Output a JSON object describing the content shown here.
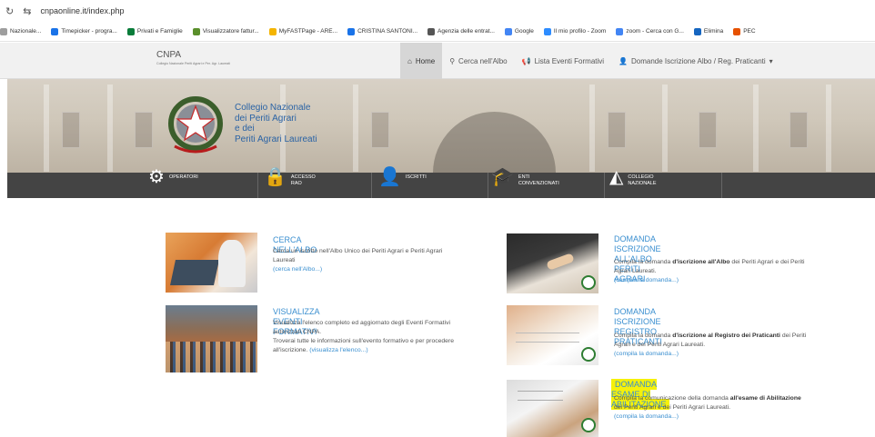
{
  "browser": {
    "url": "cnpaonline.it/index.php",
    "bookmarks": [
      {
        "label": "Nazionale...",
        "color": "#9e9e9e"
      },
      {
        "label": "Timepicker - progra...",
        "color": "#1a73e8"
      },
      {
        "label": "Privati e Famiglie",
        "color": "#0a7c3a"
      },
      {
        "label": "Visualizzatore fattur...",
        "color": "#5a8f2b"
      },
      {
        "label": "MyFASTPage - ARE...",
        "color": "#f4b400"
      },
      {
        "label": "CRISTINA SANTONI...",
        "color": "#1a73e8"
      },
      {
        "label": "Agenzia delle entrat...",
        "color": "#555555"
      },
      {
        "label": "Google",
        "color": "#4285f4"
      },
      {
        "label": "Il mio profilo - Zoom",
        "color": "#2d8cff"
      },
      {
        "label": "zoom - Cerca con G...",
        "color": "#4285f4"
      },
      {
        "label": "Elimina",
        "color": "#1565c0"
      },
      {
        "label": "PEC",
        "color": "#e65100"
      }
    ]
  },
  "site": {
    "brand_title": "CNPA",
    "brand_subtitle": "Collegio Nazionale Periti Agrari e Per. Agr. Laureati",
    "nav": [
      {
        "label": "Home",
        "icon": "home-icon",
        "glyph": "⌂",
        "active": true
      },
      {
        "label": "Cerca nell'Albo",
        "icon": "search-icon",
        "glyph": "⚲",
        "active": false
      },
      {
        "label": "Lista Eventi Formativi",
        "icon": "megaphone-icon",
        "glyph": "📢",
        "active": false
      },
      {
        "label": "Domande Iscrizione Albo / Reg. Praticanti",
        "icon": "user-add-icon",
        "glyph": "👤",
        "active": false,
        "dropdown": "▾"
      }
    ],
    "banner_text": [
      "Collegio Nazionale",
      "dei Periti Agrari",
      "e dei",
      "Periti Agrari Laureati"
    ],
    "menu": [
      {
        "line1": "OPERATORI",
        "line2": "",
        "icon": "gear-icon",
        "glyph": "⚙"
      },
      {
        "line1": "ACCESSO",
        "line2": "RAO",
        "icon": "lock-icon",
        "glyph": "🔒"
      },
      {
        "line1": "ISCRITTI",
        "line2": "",
        "icon": "person-icon",
        "glyph": "👤"
      },
      {
        "line1": "ENTI",
        "line2": "CONVENZIONATI",
        "icon": "graduation-cap-icon",
        "glyph": "🎓"
      },
      {
        "line1": "COLLEGIO",
        "line2": "NAZIONALE",
        "icon": "italy-map-icon",
        "glyph": "◭"
      }
    ]
  },
  "cards": {
    "cerca": {
      "title": "CERCA NELL'ALBO",
      "text": "Cerca un iscritto nell'Albo Unico dei Periti Agrari e Periti Agrari Laureati",
      "link": "(cerca nell'Albo...)"
    },
    "eventi": {
      "title": "VISUALIZZA EVENTI FORMATIVI",
      "text1": "Visualizza l'elenco completo ed aggiornato degli Eventi Formativi autorizzati CNPA.",
      "text2": "Troverai tutte le informazioni sull'evento formativo e per procedere all'iscrizione.",
      "link": "(visualizza l'elenco...)"
    },
    "iscrizione_albo": {
      "title_line1": "DOMANDA ISCRIZIONE ALL'ALBO PERITI",
      "title_line2": "AGRARI",
      "pre": "Compila la domanda",
      "bold": "d'iscrizione all'Albo",
      "post": "dei Periti Agrari e dei Periti Agrari Laureati.",
      "link": "(compila la domanda...)"
    },
    "registro": {
      "title_line1": "DOMANDA ISCRIZIONE REGISTRO",
      "title_line2": "PRATICANTI",
      "pre": "Compila la domanda",
      "bold": "d'iscrizione al Registro dei Praticanti",
      "post": "dei Periti Agrari e dei Periti Agrari Laureati.",
      "link": "(compila la domanda...)"
    },
    "esame": {
      "title": "DOMANDA ESAME DI ABILITAZIONE",
      "pre": "Compila la comunicazione della domanda",
      "bold": "all'esame di Abilitazione",
      "post": "dei Periti Agrari e dei Periti Agrari Laureati.",
      "link": "(compila la domanda...)",
      "highlight_color": "#f5f10a"
    }
  },
  "colors": {
    "link": "#3a8fd0",
    "menubar": "#444444",
    "navbar": "#f1f1f1"
  }
}
